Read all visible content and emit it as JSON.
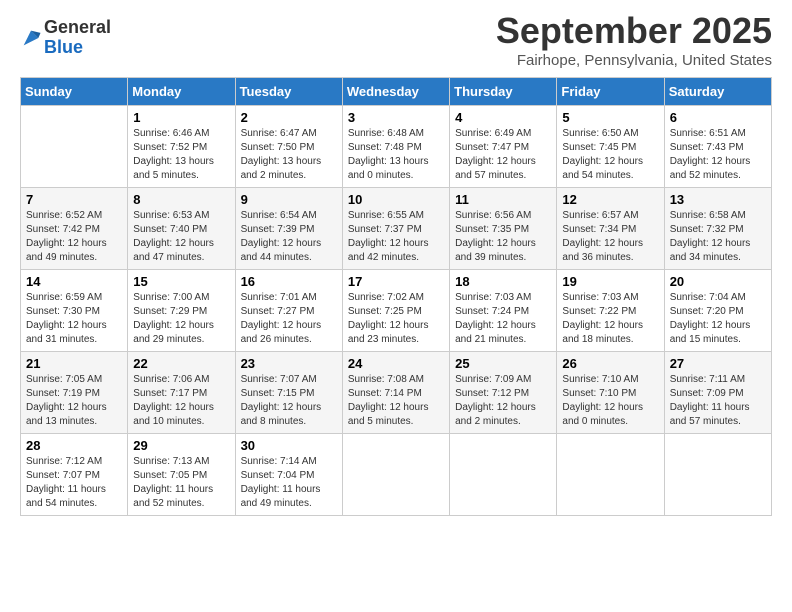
{
  "header": {
    "logo_general": "General",
    "logo_blue": "Blue",
    "month_title": "September 2025",
    "location": "Fairhope, Pennsylvania, United States"
  },
  "weekdays": [
    "Sunday",
    "Monday",
    "Tuesday",
    "Wednesday",
    "Thursday",
    "Friday",
    "Saturday"
  ],
  "weeks": [
    [
      {
        "day": "",
        "info": ""
      },
      {
        "day": "1",
        "info": "Sunrise: 6:46 AM\nSunset: 7:52 PM\nDaylight: 13 hours\nand 5 minutes."
      },
      {
        "day": "2",
        "info": "Sunrise: 6:47 AM\nSunset: 7:50 PM\nDaylight: 13 hours\nand 2 minutes."
      },
      {
        "day": "3",
        "info": "Sunrise: 6:48 AM\nSunset: 7:48 PM\nDaylight: 13 hours\nand 0 minutes."
      },
      {
        "day": "4",
        "info": "Sunrise: 6:49 AM\nSunset: 7:47 PM\nDaylight: 12 hours\nand 57 minutes."
      },
      {
        "day": "5",
        "info": "Sunrise: 6:50 AM\nSunset: 7:45 PM\nDaylight: 12 hours\nand 54 minutes."
      },
      {
        "day": "6",
        "info": "Sunrise: 6:51 AM\nSunset: 7:43 PM\nDaylight: 12 hours\nand 52 minutes."
      }
    ],
    [
      {
        "day": "7",
        "info": "Sunrise: 6:52 AM\nSunset: 7:42 PM\nDaylight: 12 hours\nand 49 minutes."
      },
      {
        "day": "8",
        "info": "Sunrise: 6:53 AM\nSunset: 7:40 PM\nDaylight: 12 hours\nand 47 minutes."
      },
      {
        "day": "9",
        "info": "Sunrise: 6:54 AM\nSunset: 7:39 PM\nDaylight: 12 hours\nand 44 minutes."
      },
      {
        "day": "10",
        "info": "Sunrise: 6:55 AM\nSunset: 7:37 PM\nDaylight: 12 hours\nand 42 minutes."
      },
      {
        "day": "11",
        "info": "Sunrise: 6:56 AM\nSunset: 7:35 PM\nDaylight: 12 hours\nand 39 minutes."
      },
      {
        "day": "12",
        "info": "Sunrise: 6:57 AM\nSunset: 7:34 PM\nDaylight: 12 hours\nand 36 minutes."
      },
      {
        "day": "13",
        "info": "Sunrise: 6:58 AM\nSunset: 7:32 PM\nDaylight: 12 hours\nand 34 minutes."
      }
    ],
    [
      {
        "day": "14",
        "info": "Sunrise: 6:59 AM\nSunset: 7:30 PM\nDaylight: 12 hours\nand 31 minutes."
      },
      {
        "day": "15",
        "info": "Sunrise: 7:00 AM\nSunset: 7:29 PM\nDaylight: 12 hours\nand 29 minutes."
      },
      {
        "day": "16",
        "info": "Sunrise: 7:01 AM\nSunset: 7:27 PM\nDaylight: 12 hours\nand 26 minutes."
      },
      {
        "day": "17",
        "info": "Sunrise: 7:02 AM\nSunset: 7:25 PM\nDaylight: 12 hours\nand 23 minutes."
      },
      {
        "day": "18",
        "info": "Sunrise: 7:03 AM\nSunset: 7:24 PM\nDaylight: 12 hours\nand 21 minutes."
      },
      {
        "day": "19",
        "info": "Sunrise: 7:03 AM\nSunset: 7:22 PM\nDaylight: 12 hours\nand 18 minutes."
      },
      {
        "day": "20",
        "info": "Sunrise: 7:04 AM\nSunset: 7:20 PM\nDaylight: 12 hours\nand 15 minutes."
      }
    ],
    [
      {
        "day": "21",
        "info": "Sunrise: 7:05 AM\nSunset: 7:19 PM\nDaylight: 12 hours\nand 13 minutes."
      },
      {
        "day": "22",
        "info": "Sunrise: 7:06 AM\nSunset: 7:17 PM\nDaylight: 12 hours\nand 10 minutes."
      },
      {
        "day": "23",
        "info": "Sunrise: 7:07 AM\nSunset: 7:15 PM\nDaylight: 12 hours\nand 8 minutes."
      },
      {
        "day": "24",
        "info": "Sunrise: 7:08 AM\nSunset: 7:14 PM\nDaylight: 12 hours\nand 5 minutes."
      },
      {
        "day": "25",
        "info": "Sunrise: 7:09 AM\nSunset: 7:12 PM\nDaylight: 12 hours\nand 2 minutes."
      },
      {
        "day": "26",
        "info": "Sunrise: 7:10 AM\nSunset: 7:10 PM\nDaylight: 12 hours\nand 0 minutes."
      },
      {
        "day": "27",
        "info": "Sunrise: 7:11 AM\nSunset: 7:09 PM\nDaylight: 11 hours\nand 57 minutes."
      }
    ],
    [
      {
        "day": "28",
        "info": "Sunrise: 7:12 AM\nSunset: 7:07 PM\nDaylight: 11 hours\nand 54 minutes."
      },
      {
        "day": "29",
        "info": "Sunrise: 7:13 AM\nSunset: 7:05 PM\nDaylight: 11 hours\nand 52 minutes."
      },
      {
        "day": "30",
        "info": "Sunrise: 7:14 AM\nSunset: 7:04 PM\nDaylight: 11 hours\nand 49 minutes."
      },
      {
        "day": "",
        "info": ""
      },
      {
        "day": "",
        "info": ""
      },
      {
        "day": "",
        "info": ""
      },
      {
        "day": "",
        "info": ""
      }
    ]
  ]
}
